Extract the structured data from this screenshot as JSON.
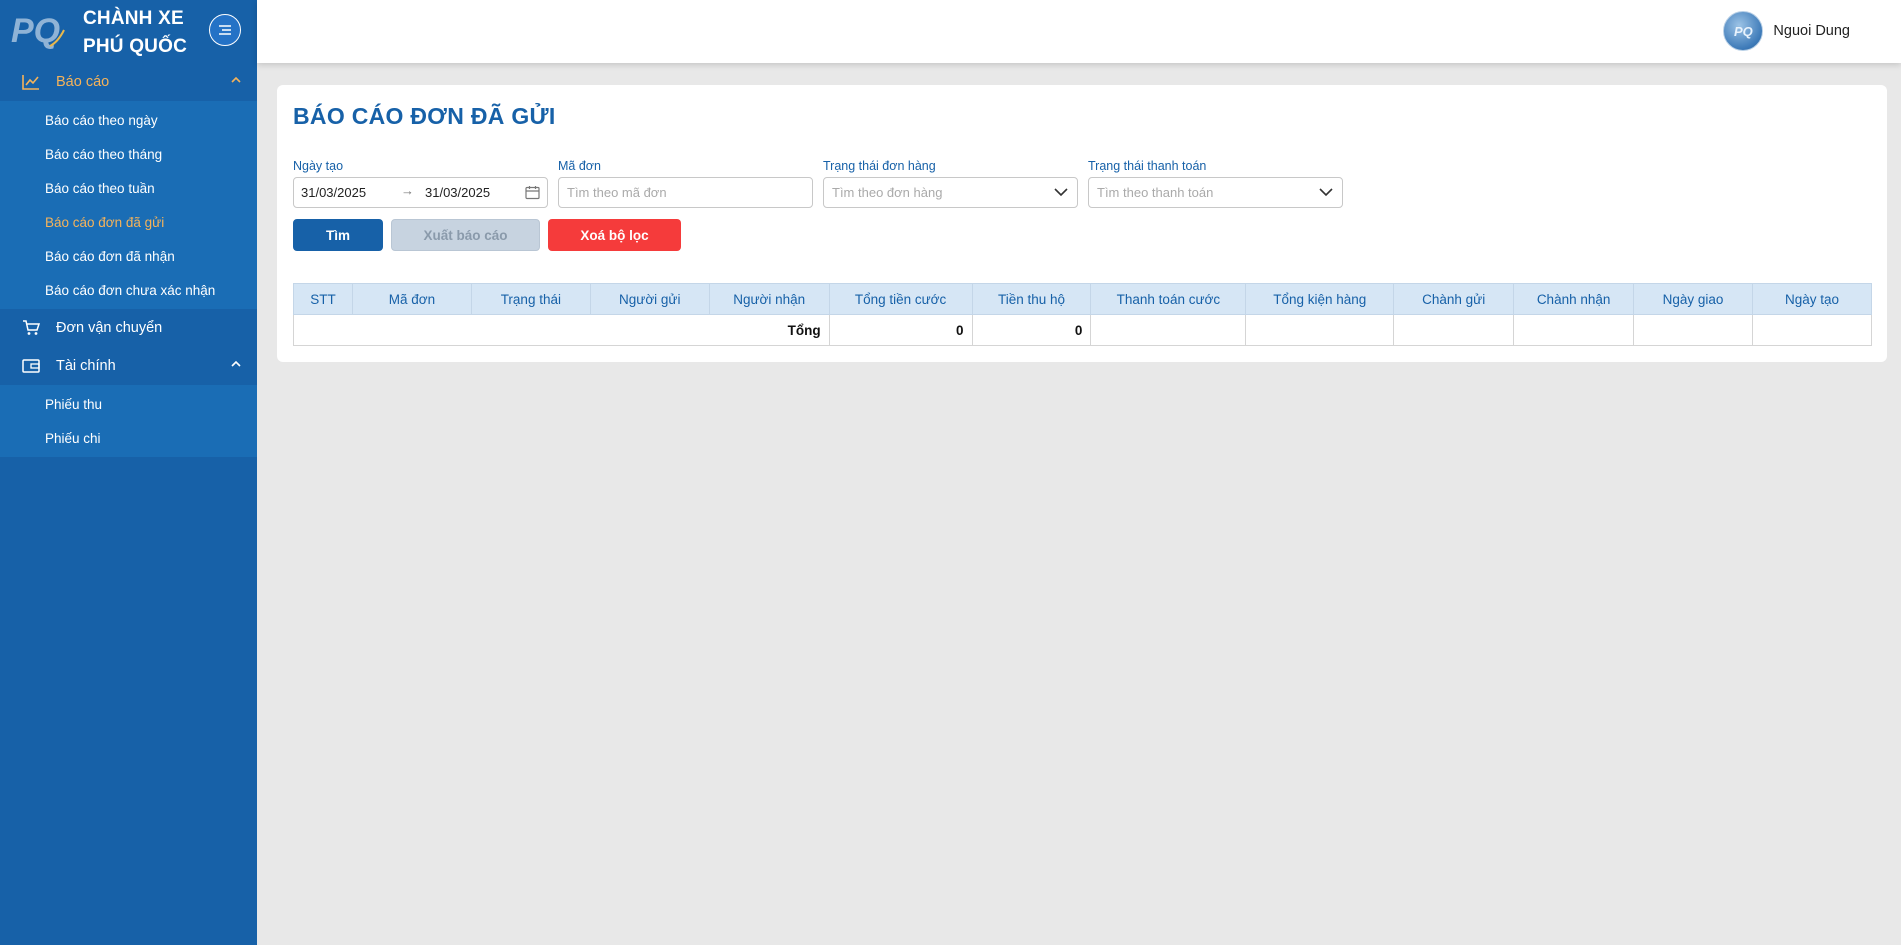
{
  "brand": {
    "line1": "CHÀNH XE",
    "line2": "PHÚ QUỐC",
    "logo_text": "PQ"
  },
  "sidebar": {
    "groups": [
      {
        "label": "Báo cáo",
        "icon": "line-chart-icon",
        "expanded": true,
        "active": true,
        "items": [
          "Báo cáo theo ngày",
          "Báo cáo theo tháng",
          "Báo cáo theo tuần",
          "Báo cáo đơn đã gửi",
          "Báo cáo đơn đã nhận",
          "Báo cáo đơn chưa xác nhận"
        ],
        "active_item": "Báo cáo đơn đã gửi"
      },
      {
        "label": "Đơn vận chuyển",
        "icon": "cart-icon"
      },
      {
        "label": "Tài chính",
        "icon": "wallet-icon",
        "expanded": true,
        "items": [
          "Phiếu thu",
          "Phiếu chi"
        ]
      }
    ]
  },
  "header": {
    "user_name": "Nguoi Dung"
  },
  "page": {
    "title": "BÁO CÁO ĐƠN ĐÃ GỬI"
  },
  "filters": {
    "date": {
      "label": "Ngày tạo",
      "from": "31/03/2025",
      "arrow": "→",
      "to": "31/03/2025"
    },
    "code": {
      "label": "Mã đơn",
      "placeholder": "Tìm theo mã đơn"
    },
    "order_status": {
      "label": "Trạng thái đơn hàng",
      "placeholder": "Tìm theo đơn hàng"
    },
    "payment_status": {
      "label": "Trạng thái thanh toán",
      "placeholder": "Tìm theo thanh toán"
    }
  },
  "buttons": {
    "search": "Tìm",
    "export": "Xuất báo cáo",
    "clear": "Xoá bộ lọc"
  },
  "table": {
    "columns": [
      "STT",
      "Mã đơn",
      "Trạng thái",
      "Người gửi",
      "Người nhận",
      "Tổng tiền cước",
      "Tiền thu hộ",
      "Thanh toán cước",
      "Tổng kiện hàng",
      "Chành gửi",
      "Chành nhận",
      "Ngày giao",
      "Ngày tạo"
    ],
    "total_row": {
      "label": "Tổng",
      "total_fee": "0",
      "cod": "0"
    }
  },
  "colors": {
    "primary": "#1761a8",
    "accent": "#f5b35a",
    "danger": "#f53b3b"
  }
}
